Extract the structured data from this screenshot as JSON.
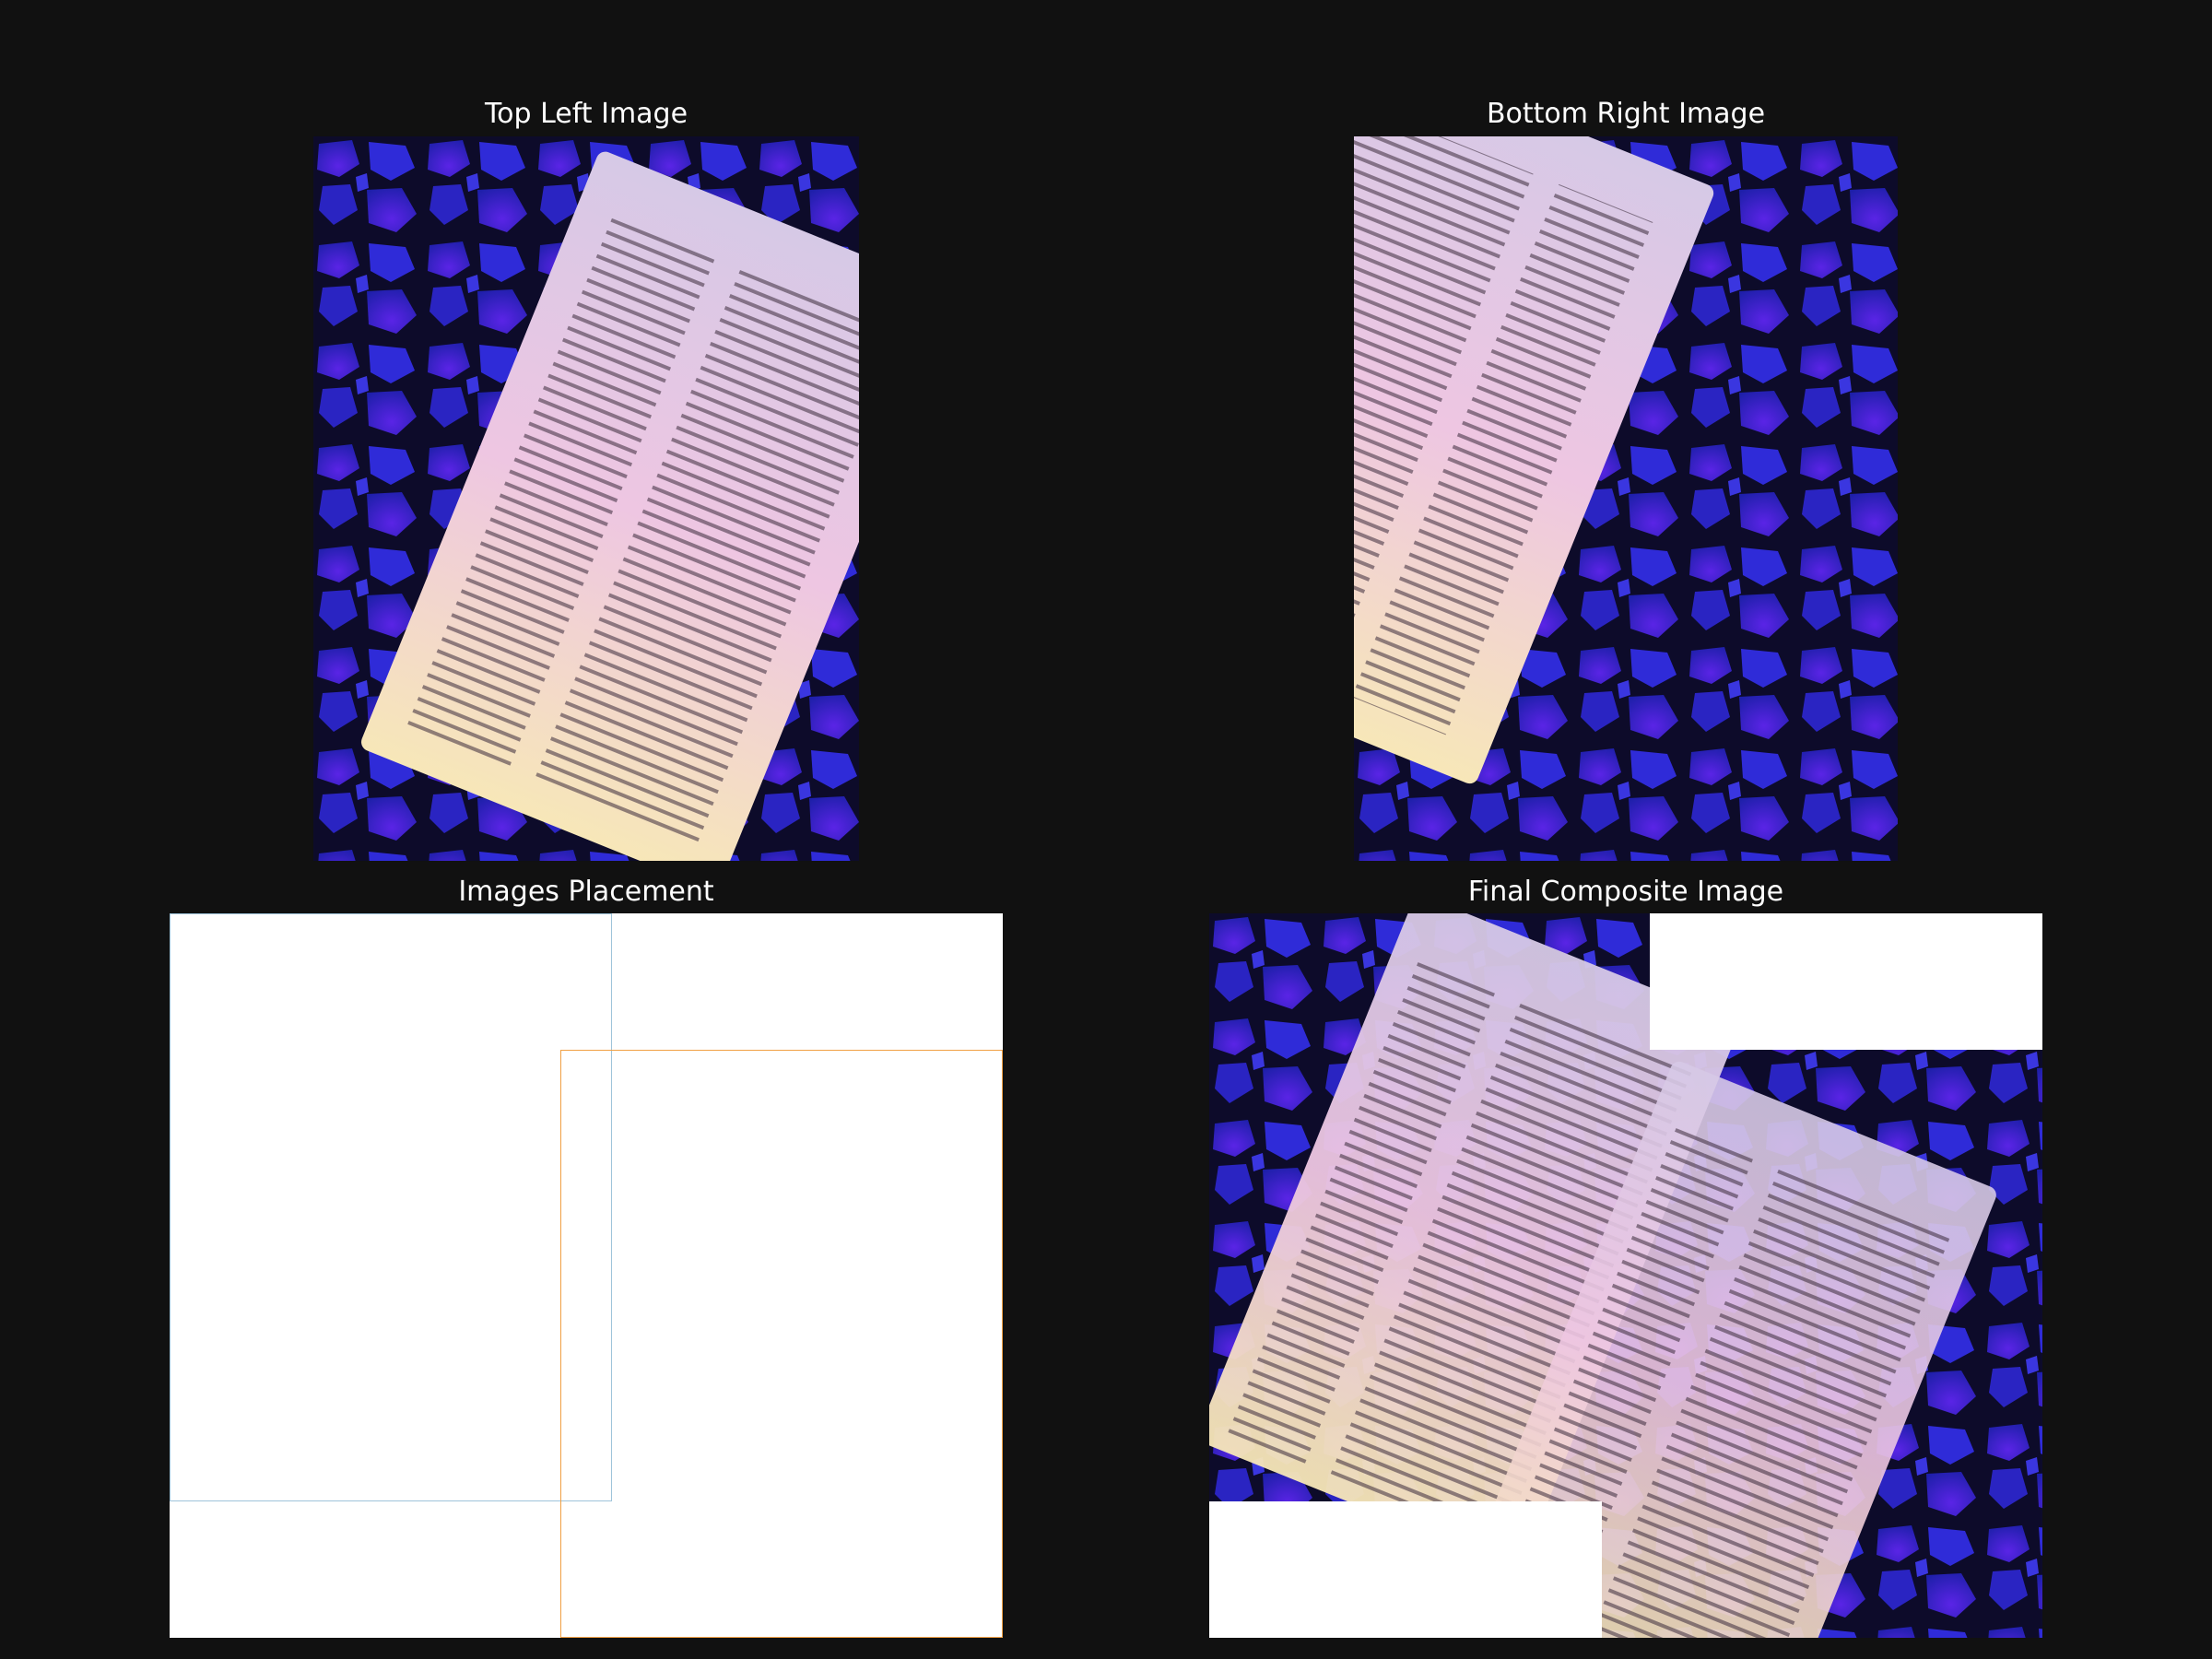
{
  "panels": {
    "top_left": {
      "title": "Top Left Image"
    },
    "bottom_right": {
      "title": "Bottom Right Image"
    },
    "placement": {
      "title": "Images Placement"
    },
    "composite": {
      "title": "Final Composite Image"
    }
  },
  "colors": {
    "background": "#111111",
    "top_left_outline": "#9fc4da",
    "bottom_right_outline": "#f0a044",
    "backdrop_blue": "#2a1ec8",
    "paper_light": "#f1dcdf"
  },
  "icons": {
    "photo_top_left": "document-photo-icon",
    "photo_bottom_right": "document-photo-icon"
  }
}
